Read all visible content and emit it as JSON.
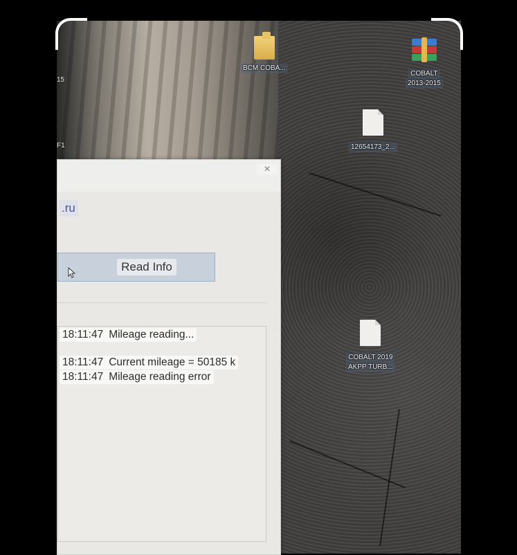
{
  "desktop": {
    "icons": [
      {
        "label": "BCM COBA...",
        "type": "folder"
      },
      {
        "label_lines": [
          "COBALT",
          "2013-2015"
        ],
        "type": "archive"
      },
      {
        "label": "12654173_2...",
        "type": "file"
      },
      {
        "label_lines": [
          "COBALT 2019",
          "AKPP TURB..."
        ],
        "type": "file"
      }
    ],
    "left_edge_text": [
      "15",
      "F1"
    ]
  },
  "window": {
    "close_label": "×",
    "site_text": ".ru",
    "read_button_label": "Read Info",
    "log": [
      {
        "time": "18:11:47",
        "message": "Mileage reading..."
      },
      {
        "time": "18:11:47",
        "message": "Current mileage  =  50185 k"
      },
      {
        "time": "18:11:47",
        "message": "Mileage reading error"
      }
    ]
  }
}
